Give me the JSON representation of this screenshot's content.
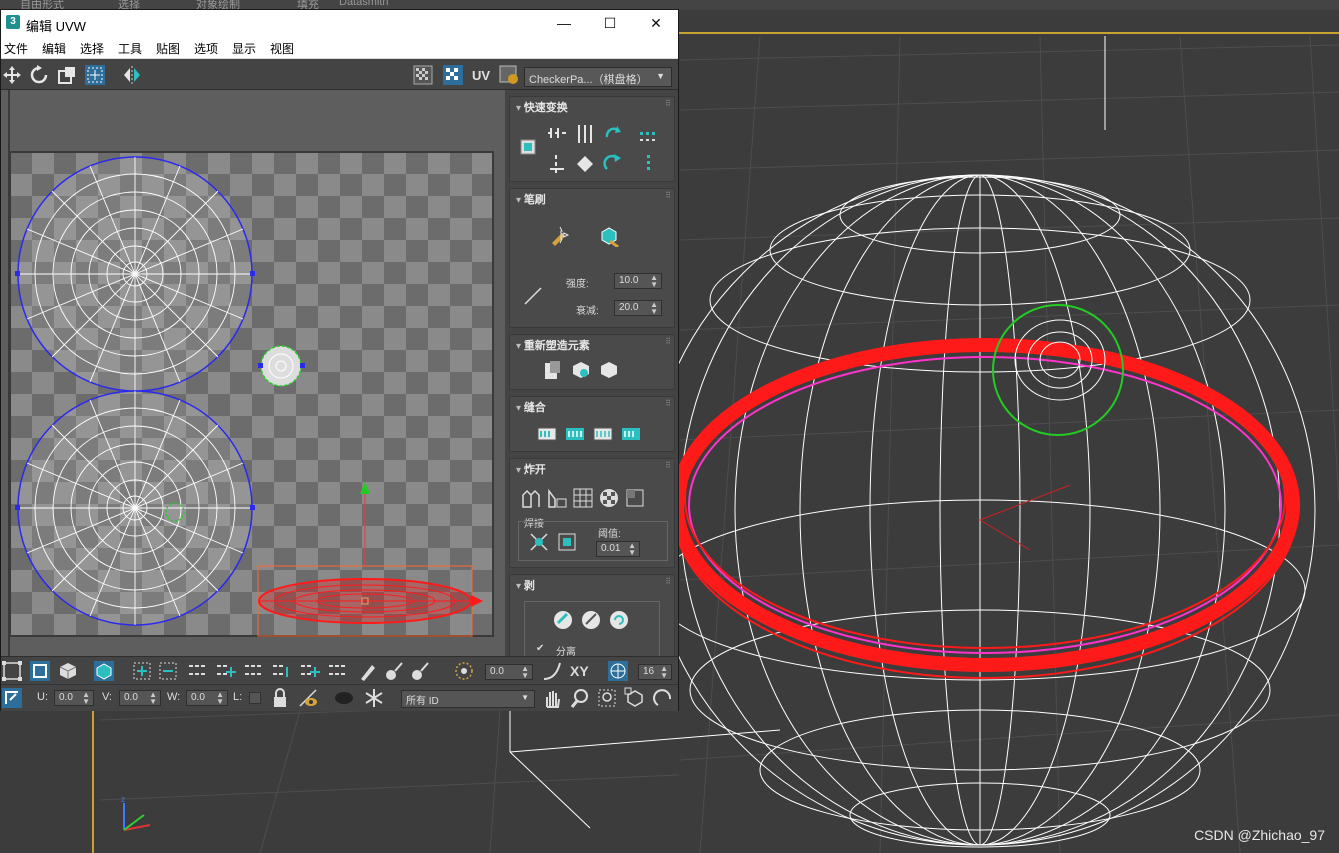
{
  "background": {
    "top_menu": [
      "自由形式",
      "选择",
      "对象绘制",
      "填充",
      "Datasmith"
    ],
    "watermark": "CSDN @Zhichao_97",
    "colors": {
      "frame": "#c9a230",
      "selected": "#ff1a1a",
      "gizmo": "#22cc22",
      "seam": "#ff33cc"
    }
  },
  "window": {
    "app_icon": "3",
    "title": "编辑 UVW",
    "buttons": {
      "minimize": "—",
      "maximize": "☐",
      "close": "✕"
    }
  },
  "menu": [
    "文件",
    "编辑",
    "选择",
    "工具",
    "贴图",
    "选项",
    "显示",
    "视图"
  ],
  "top_toolbar": {
    "uv_label": "UV",
    "texture_select": "CheckerPa...（棋盘格）",
    "icons": [
      "move-icon",
      "rotate-icon",
      "scale-icon",
      "freeform-icon",
      "mirror-icon",
      "show-map-icon",
      "checker-icon",
      "map-settings-icon"
    ]
  },
  "panels": {
    "quick_transform": {
      "title": "快速变换"
    },
    "brush": {
      "title": "笔刷",
      "strength_label": "强度:",
      "strength_value": "10.0",
      "falloff_label": "衰减:",
      "falloff_value": "20.0"
    },
    "reshape": {
      "title": "重新塑造元素"
    },
    "stitch": {
      "title": "缝合"
    },
    "explode": {
      "title": "炸开",
      "weld_label": "焊接",
      "threshold_label": "阈值:",
      "threshold_value": "0.01"
    },
    "peel": {
      "title": "剥",
      "detach_label": "分离",
      "detach_checked": "✔"
    }
  },
  "bottom_toolbar": {
    "angle_value": "0.0",
    "xy_label": "XY",
    "grid_value": "16",
    "u_label": "U:",
    "u_value": "0.0",
    "v_label": "V:",
    "v_value": "0.0",
    "w_label": "W:",
    "w_value": "0.0",
    "l_label": "L:",
    "id_select": "所有 ID"
  }
}
